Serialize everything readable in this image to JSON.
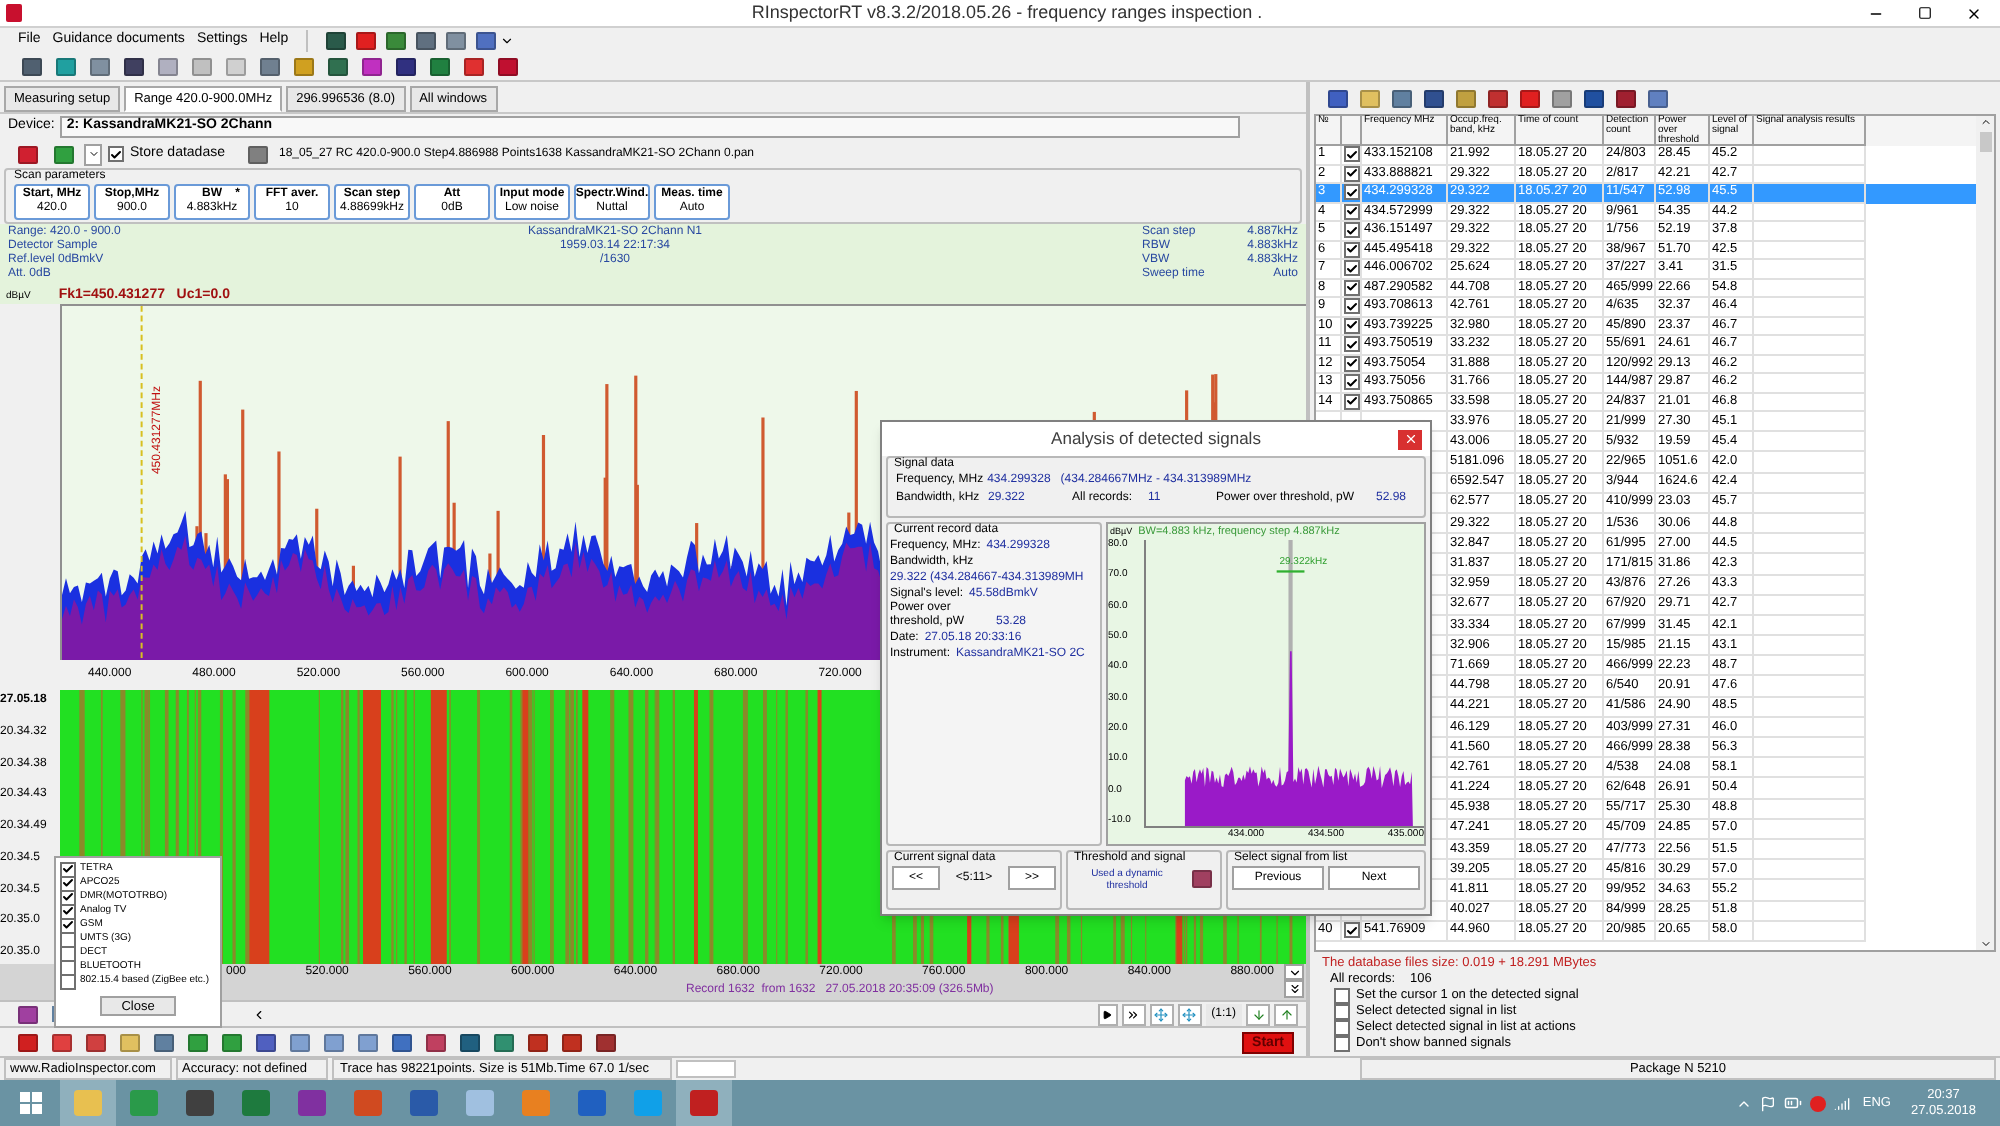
{
  "window": {
    "title": "RInspectorRT v8.3.2/2018.05.26 - frequency ranges inspection ."
  },
  "menu": [
    "File",
    "Guidance documents",
    "Settings",
    "Help"
  ],
  "tabs": [
    {
      "label": "Measuring setup",
      "selected": false
    },
    {
      "label": "Range 420.0-900.0MHz",
      "selected": true
    },
    {
      "label": "296.996536 (8.0)",
      "selected": false
    },
    {
      "label": "All windows",
      "selected": false
    }
  ],
  "device": {
    "label": "Device:",
    "value": "2: KassandraMK21-SO 2Chann"
  },
  "store_database": {
    "label": "Store datadase",
    "checked": true
  },
  "file_name": "18_05_27 RC 420.0-900.0 Step4.886988 Points1638 KassandraMK21-SO 2Chann 0.pan",
  "scan_parameters": {
    "title": "Scan parameters",
    "buttons": [
      {
        "label": "Start, MHz",
        "value": "420.0"
      },
      {
        "label": "Stop,MHz",
        "value": "900.0"
      },
      {
        "label": "BW",
        "flag": "*",
        "value": "4.883kHz"
      },
      {
        "label": "FFT aver.",
        "value": "10"
      },
      {
        "label": "Scan step",
        "value": "4.88699kHz"
      },
      {
        "label": "Att",
        "value": "0dB"
      },
      {
        "label": "Input mode",
        "value": "Low noise"
      },
      {
        "label": "Spectr.Wind.",
        "value": "Nuttal"
      },
      {
        "label": "Meas. time",
        "value": "Auto"
      }
    ]
  },
  "spectrum": {
    "info_left": [
      "Range: 420.0 - 900.0",
      "Detector Sample",
      "Ref.level 0dBmkV",
      "Att. 0dB"
    ],
    "info_center": [
      "KassandraMK21-SO 2Chann N1",
      "1959.03.14 22:17:34",
      "/1630"
    ],
    "info_right": [
      {
        "label": "Scan step",
        "value": "4.887kHz"
      },
      {
        "label": "RBW",
        "value": "4.883kHz"
      },
      {
        "label": "VBW",
        "value": "4.883kHz"
      },
      {
        "label": "Sweep time",
        "value": "Auto"
      }
    ],
    "unit": "dBµV",
    "marker": "Fk1=450.431277   Uc1=0.0",
    "marker_frequency": "450.431277MHz",
    "x_labels": [
      "440.000",
      "480.000",
      "520.000",
      "560.000",
      "600.000",
      "640.000",
      "680.000",
      "720.000"
    ]
  },
  "waterfall": {
    "date": "27.05.18",
    "times": [
      "20.34.32",
      "20.34.38",
      "20.34.43",
      "20.34.49",
      "20.34.5",
      "20.34.5",
      "20.35.0",
      "20.35.0"
    ],
    "x_labels": [
      "000",
      "520.000",
      "560.000",
      "600.000",
      "640.000",
      "680.000",
      "720.000",
      "760.000",
      "800.000",
      "840.000",
      "880.000"
    ],
    "record": "Record 1632  from 1632   27.05.2018 20:35:09 (326.5Mb)"
  },
  "legend": {
    "items": [
      {
        "label": "TETRA",
        "checked": true
      },
      {
        "label": "APCO25",
        "checked": true
      },
      {
        "label": "DMR(MOTOTRBO)",
        "checked": true
      },
      {
        "label": "Analog TV",
        "checked": true
      },
      {
        "label": "GSM",
        "checked": true
      },
      {
        "label": "UMTS (3G)",
        "checked": false
      },
      {
        "label": "DECT",
        "checked": false
      },
      {
        "label": "BLUETOOTH",
        "checked": false
      },
      {
        "label": "802.15.4 based (ZigBee etc.)",
        "checked": false
      }
    ],
    "close": "Close"
  },
  "navigation": {
    "zoom": "(1:1)",
    "start": "Start"
  },
  "table": {
    "columns": [
      "№",
      "Frequency MHz",
      "Occup.freq. band, kHz",
      "Time of count",
      "Detection count",
      "Power over threshold",
      "Level of signal",
      "Signal analysis results"
    ],
    "rows": [
      {
        "number": "1",
        "checked": true,
        "frequency": "433.152108",
        "band": "21.992",
        "time": "18.05.27 20",
        "detection": "24/803",
        "power": "28.45",
        "level": "45.2",
        "selected": false
      },
      {
        "number": "2",
        "checked": true,
        "frequency": "433.888821",
        "band": "29.322",
        "time": "18.05.27 20",
        "detection": "2/817",
        "power": "42.21",
        "level": "42.7",
        "selected": false
      },
      {
        "number": "3",
        "checked": true,
        "frequency": "434.299328",
        "band": "29.322",
        "time": "18.05.27 20",
        "detection": "11/547",
        "power": "52.98",
        "level": "45.5",
        "selected": true
      },
      {
        "number": "4",
        "checked": true,
        "frequency": "434.572999",
        "band": "29.322",
        "time": "18.05.27 20",
        "detection": "9/961",
        "power": "54.35",
        "level": "44.2",
        "selected": false
      },
      {
        "number": "5",
        "checked": true,
        "frequency": "436.151497",
        "band": "29.322",
        "time": "18.05.27 20",
        "detection": "1/756",
        "power": "52.19",
        "level": "37.8",
        "selected": false
      },
      {
        "number": "6",
        "checked": true,
        "frequency": "445.495418",
        "band": "29.322",
        "time": "18.05.27 20",
        "detection": "38/967",
        "power": "51.70",
        "level": "42.5",
        "selected": false
      },
      {
        "number": "7",
        "checked": true,
        "frequency": "446.006702",
        "band": "25.624",
        "time": "18.05.27 20",
        "detection": "37/227",
        "power": "3.41",
        "level": "31.5",
        "selected": false
      },
      {
        "number": "8",
        "checked": true,
        "frequency": "487.290582",
        "band": "44.708",
        "time": "18.05.27 20",
        "detection": "465/999",
        "power": "22.66",
        "level": "54.8",
        "selected": false
      },
      {
        "number": "9",
        "checked": true,
        "frequency": "493.708613",
        "band": "42.761",
        "time": "18.05.27 20",
        "detection": "4/635",
        "power": "32.37",
        "level": "46.4",
        "selected": false
      },
      {
        "number": "10",
        "checked": true,
        "frequency": "493.739225",
        "band": "32.980",
        "time": "18.05.27 20",
        "detection": "45/890",
        "power": "23.37",
        "level": "46.7",
        "selected": false
      },
      {
        "number": "11",
        "checked": true,
        "frequency": "493.750519",
        "band": "33.232",
        "time": "18.05.27 20",
        "detection": "55/691",
        "power": "24.61",
        "level": "46.7",
        "selected": false
      },
      {
        "number": "12",
        "checked": true,
        "frequency": "493.75054",
        "band": "31.888",
        "time": "18.05.27 20",
        "detection": "120/992",
        "power": "29.13",
        "level": "46.2",
        "selected": false
      },
      {
        "number": "13",
        "checked": true,
        "frequency": "493.75056",
        "band": "31.766",
        "time": "18.05.27 20",
        "detection": "144/987",
        "power": "29.87",
        "level": "46.2",
        "selected": false
      },
      {
        "number": "14",
        "checked": true,
        "frequency": "493.750865",
        "band": "33.598",
        "time": "18.05.27 20",
        "detection": "24/837",
        "power": "21.01",
        "level": "46.8",
        "selected": false
      },
      {
        "band": "33.976",
        "time": "18.05.27 20",
        "detection": "21/999",
        "power": "27.30",
        "level": "45.1",
        "selected": false
      },
      {
        "band": "43.006",
        "time": "18.05.27 20",
        "detection": "5/932",
        "power": "19.59",
        "level": "45.4",
        "selected": false
      },
      {
        "band": "5181.096",
        "time": "18.05.27 20",
        "detection": "22/965",
        "power": "1051.6",
        "level": "42.0",
        "selected": false
      },
      {
        "band": "6592.547",
        "time": "18.05.27 20",
        "detection": "3/944",
        "power": "1624.6",
        "level": "42.4",
        "selected": false
      },
      {
        "band": "62.577",
        "time": "18.05.27 20",
        "detection": "410/999",
        "power": "23.03",
        "level": "45.7",
        "selected": false
      },
      {
        "band": "29.322",
        "time": "18.05.27 20",
        "detection": "1/536",
        "power": "30.06",
        "level": "44.8",
        "selected": false
      },
      {
        "band": "32.847",
        "time": "18.05.27 20",
        "detection": "61/995",
        "power": "27.00",
        "level": "44.5",
        "selected": false
      },
      {
        "band": "31.837",
        "time": "18.05.27 20",
        "detection": "171/815",
        "power": "31.86",
        "level": "42.3",
        "selected": false
      },
      {
        "band": "32.959",
        "time": "18.05.27 20",
        "detection": "43/876",
        "power": "27.26",
        "level": "43.3",
        "selected": false
      },
      {
        "band": "32.677",
        "time": "18.05.27 20",
        "detection": "67/920",
        "power": "29.71",
        "level": "42.7",
        "selected": false
      },
      {
        "band": "33.334",
        "time": "18.05.27 20",
        "detection": "67/999",
        "power": "31.45",
        "level": "42.1",
        "selected": false
      },
      {
        "band": "32.906",
        "time": "18.05.27 20",
        "detection": "15/985",
        "power": "21.15",
        "level": "43.1",
        "selected": false
      },
      {
        "band": "71.669",
        "time": "18.05.27 20",
        "detection": "466/999",
        "power": "22.23",
        "level": "48.7",
        "selected": false
      },
      {
        "band": "44.798",
        "time": "18.05.27 20",
        "detection": "6/540",
        "power": "20.91",
        "level": "47.6",
        "selected": false
      },
      {
        "band": "44.221",
        "time": "18.05.27 20",
        "detection": "41/586",
        "power": "24.90",
        "level": "48.5",
        "selected": false
      },
      {
        "band": "46.129",
        "time": "18.05.27 20",
        "detection": "403/999",
        "power": "27.31",
        "level": "46.0",
        "selected": false
      },
      {
        "band": "41.560",
        "time": "18.05.27 20",
        "detection": "466/999",
        "power": "28.38",
        "level": "56.3",
        "selected": false
      },
      {
        "band": "42.761",
        "time": "18.05.27 20",
        "detection": "4/538",
        "power": "24.08",
        "level": "58.1",
        "selected": false
      },
      {
        "band": "41.224",
        "time": "18.05.27 20",
        "detection": "62/648",
        "power": "26.91",
        "level": "50.4",
        "selected": false
      },
      {
        "band": "45.938",
        "time": "18.05.27 20",
        "detection": "55/717",
        "power": "25.30",
        "level": "48.8",
        "selected": false
      },
      {
        "band": "47.241",
        "time": "18.05.27 20",
        "detection": "45/709",
        "power": "24.85",
        "level": "57.0",
        "selected": false
      },
      {
        "band": "43.359",
        "time": "18.05.27 20",
        "detection": "47/773",
        "power": "22.56",
        "level": "51.5",
        "selected": false
      },
      {
        "band": "39.205",
        "time": "18.05.27 20",
        "detection": "45/816",
        "power": "30.29",
        "level": "57.0",
        "selected": false
      },
      {
        "band": "41.811",
        "time": "18.05.27 20",
        "detection": "99/952",
        "power": "34.63",
        "level": "55.2",
        "selected": false
      },
      {
        "band": "40.027",
        "time": "18.05.27 20",
        "detection": "84/999",
        "power": "28.25",
        "level": "51.8",
        "selected": false
      },
      {
        "number": "40",
        "checked": true,
        "frequency": "541.76909",
        "band": "44.960",
        "time": "18.05.27 20",
        "detection": "20/985",
        "power": "20.65",
        "level": "58.0",
        "selected": false
      }
    ]
  },
  "database": {
    "size": "The database files size: 0.019 + 18.291 MBytes",
    "records_label": "All records:",
    "records": "106",
    "options": [
      {
        "label": "Set the cursor 1 on the detected signal",
        "checked": false
      },
      {
        "label": "Select detected signal in list",
        "checked": false
      },
      {
        "label": "Select detected signal in list at actions",
        "checked": false
      },
      {
        "label": "Don't show banned signals",
        "checked": false
      }
    ]
  },
  "analysis_dialog": {
    "title": "Analysis of detected signals",
    "signal_data": {
      "title": "Signal data",
      "frequency_label": "Frequency, MHz",
      "frequency": "434.299328",
      "frequency_range": "(434.284667MHz - 434.313989MHz",
      "bandwidth_label": "Bandwidth, kHz",
      "bandwidth": "29.322",
      "records_label": "All records:",
      "records": "11",
      "power_label": "Power over threshold, pW",
      "power": "52.98"
    },
    "current_record": {
      "title": "Current record data",
      "lines": [
        {
          "label": "Frequency, MHz:",
          "value": "434.299328"
        },
        {
          "label": "Bandwidth, kHz"
        },
        {
          "value": "29.322 (434.284667-434.313989MH"
        },
        {
          "label": "Signal's level:",
          "value": "45.58dBmkV"
        },
        {
          "label": "Power over threshold, pW",
          "value": "53.28"
        },
        {
          "label": "Date:",
          "value": "27.05.18 20:33:16"
        },
        {
          "label": "Instrument:",
          "value": "KassandraMK21-SO 2C"
        }
      ]
    },
    "chart": {
      "unit": "dBµV",
      "header": "BW=4.883 kHz, frequency step 4.887kHz",
      "y_ticks": [
        "80.0",
        "70.0",
        "60.0",
        "50.0",
        "40.0",
        "30.0",
        "20.0",
        "10.0",
        "0.0",
        "-10.0"
      ],
      "x_ticks": [
        "434.000",
        "434.500",
        "435.000"
      ],
      "bandwidth_marker": "29.322kHz"
    },
    "current_signal": {
      "title": "Current signal data",
      "previous": "<<",
      "position": "<5:11>",
      "next": ">>"
    },
    "threshold": {
      "title": "Threshold and signal",
      "text": "Used a dynamic threshold"
    },
    "select": {
      "title": "Select signal from list",
      "buttons": [
        "Previous",
        "Next"
      ]
    }
  },
  "status_bar": [
    "www.RadioInspector.com",
    "Accuracy: not defined",
    "Trace has 98221points. Size is 51Mb.Time 67.0 1/sec",
    "Package N 5210"
  ],
  "taskbar": {
    "language": "ENG",
    "time": "20:37",
    "date": "27.05.2018"
  }
}
